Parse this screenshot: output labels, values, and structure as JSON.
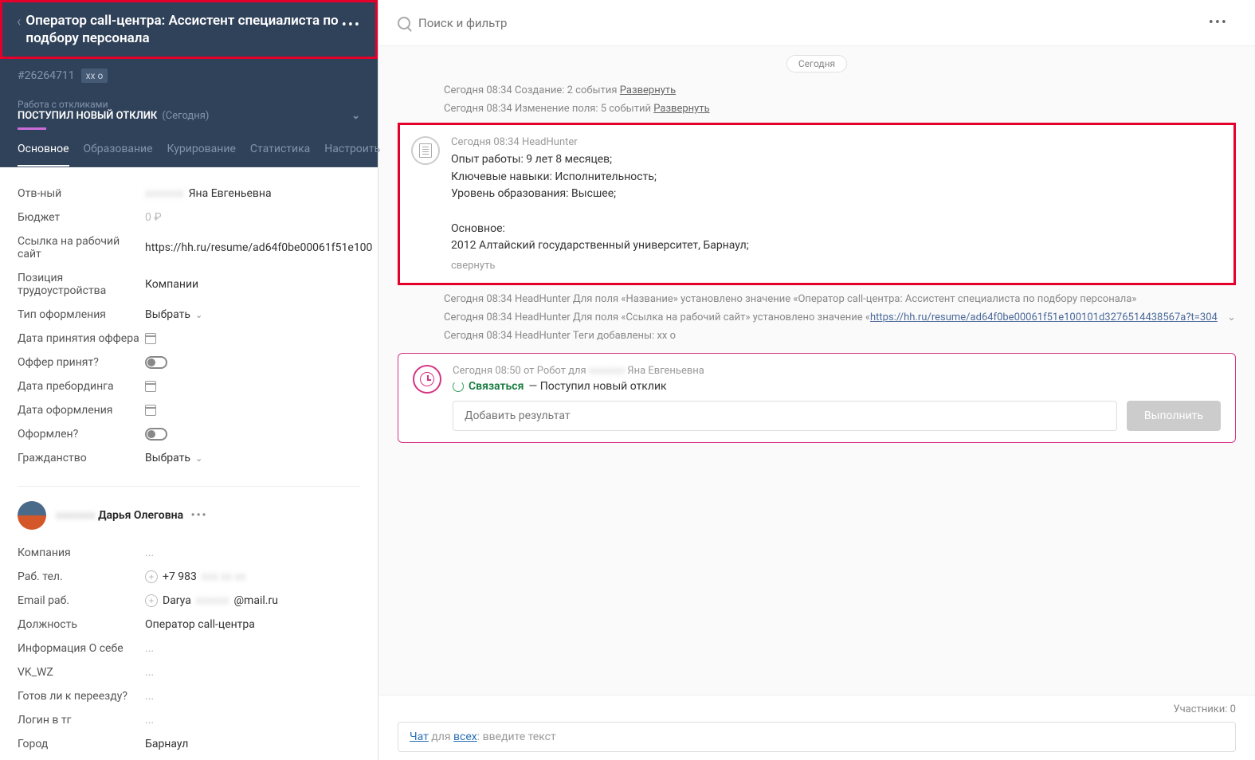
{
  "sidebar": {
    "title": "Оператор call-центра: Ассистент специалиста по подбору персонала",
    "id": "#26264711",
    "tag": "хх о",
    "section_sub": "Работа с откликами",
    "section_title": "ПОСТУПИЛ НОВЫЙ ОТКЛИК",
    "section_day": "(Сегодня)",
    "tabs": [
      "Основное",
      "Образование",
      "Курирование",
      "Статистика",
      "Настроить"
    ],
    "fields": {
      "responsible_label": "Отв-ный",
      "responsible_value": "Яна Евгеньевна",
      "budget_label": "Бюджет",
      "budget_value": "0 ₽",
      "link_label": "Ссылка на рабочий сайт",
      "link_value": "https://hh.ru/resume/ad64f0be00061f51e100",
      "position_label": "Позиция трудоустройства",
      "position_value": "Компании",
      "type_label": "Тип оформления",
      "type_value": "Выбрать",
      "offer_date_label": "Дата принятия оффера",
      "offer_accepted_label": "Оффер принят?",
      "preboarding_label": "Дата пребординга",
      "reg_date_label": "Дата оформления",
      "registered_label": "Оформлен?",
      "citizenship_label": "Гражданство",
      "citizenship_value": "Выбрать"
    },
    "contact": {
      "name": "Дарья Олеговна",
      "company_label": "Компания",
      "company_value": "...",
      "phone_label": "Раб. тел.",
      "phone_value": "+7 983",
      "email_label": "Email раб.",
      "email_prefix": "Darya",
      "email_suffix": "@mail.ru",
      "position_label": "Должность",
      "position_value": "Оператор call-центра",
      "about_label": "Информация О себе",
      "about_value": "...",
      "vk_label": "VK_WZ",
      "vk_value": "...",
      "relocate_label": "Готов ли к переезду?",
      "relocate_value": "...",
      "tg_label": "Логин в тг",
      "tg_value": "...",
      "city_label": "Город",
      "city_value": "Барнаул"
    }
  },
  "main": {
    "search_placeholder": "Поиск и фильтр",
    "day_label": "Сегодня",
    "log1_time": "Сегодня 08:34",
    "log1_text": "Создание: 2 события",
    "log1_expand": "Развернуть",
    "log2_time": "Сегодня 08:34",
    "log2_text": "Изменение поля: 5 событий",
    "log2_expand": "Развернуть",
    "hh_time": "Сегодня 08:34 HeadHunter",
    "hh_line1": "Опыт работы: 9 лет 8 месяцев;",
    "hh_line2": "Ключевые навыки: Исполнительность;",
    "hh_line3": "Уровень образования: Высшее;",
    "hh_line4": "Основное:",
    "hh_line5": "2012 Алтайский государственный университет, Барнаул;",
    "hh_collapse": "свернуть",
    "log3": "Сегодня 08:34 HeadHunter Для поля «Название» установлено значение «Оператор call-центра: Ассистент специалиста по подбору персонала»",
    "log4_prefix": "Сегодня 08:34 HeadHunter Для поля «Ссылка на рабочий сайт» установлено значение «",
    "log4_url": "https://hh.ru/resume/ad64f0be00061f51e100101d3276514438567a?t=304",
    "log4_suffix": "",
    "log5": "Сегодня 08:34 HeadHunter Теги добавлены: хх о",
    "task_meta": "Сегодня 08:50 от Робот для",
    "task_meta_name": "Яна Евгеньевна",
    "task_action": "Связаться",
    "task_desc": " — Поступил новый отклик",
    "task_input_placeholder": "Добавить результат",
    "task_btn": "Выполнить",
    "participants": "Участники: 0",
    "chat_prefix": "Чат",
    "chat_for": " для ",
    "chat_all": "всех",
    "chat_placeholder": ": введите текст"
  }
}
